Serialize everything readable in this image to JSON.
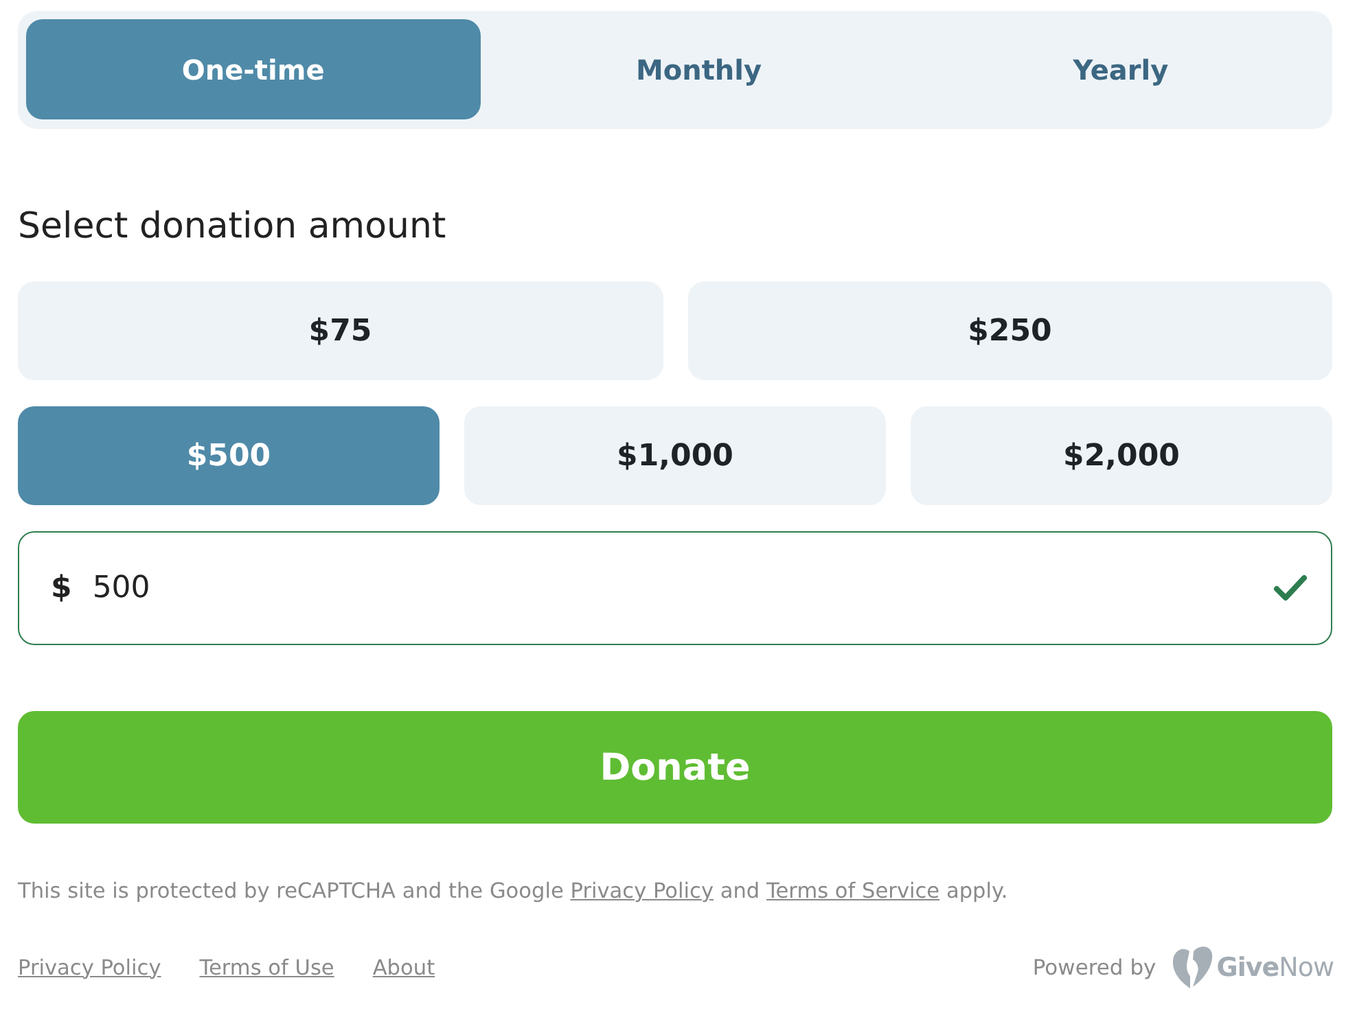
{
  "frequency_tabs": [
    {
      "label": "One-time",
      "selected": true
    },
    {
      "label": "Monthly",
      "selected": false
    },
    {
      "label": "Yearly",
      "selected": false
    }
  ],
  "amount_section": {
    "heading": "Select donation amount",
    "rows": [
      {
        "options": [
          {
            "label": "$75",
            "selected": false
          },
          {
            "label": "$250",
            "selected": false
          }
        ]
      },
      {
        "options": [
          {
            "label": "$500",
            "selected": true
          },
          {
            "label": "$1,000",
            "selected": false
          },
          {
            "label": "$2,000",
            "selected": false
          }
        ]
      }
    ]
  },
  "amount_field": {
    "currency": "$",
    "value": "500",
    "valid": true
  },
  "donate_button": {
    "label": "Donate"
  },
  "recaptcha_notice": {
    "parts": [
      {
        "kind": "text",
        "text": "This site is protected by reCAPTCHA and the Google "
      },
      {
        "kind": "link",
        "text": "Privacy Policy"
      },
      {
        "kind": "text",
        "text": " and "
      },
      {
        "kind": "link",
        "text": "Terms of Service"
      },
      {
        "kind": "text",
        "text": " apply."
      }
    ]
  },
  "footer": {
    "links": [
      "Privacy Policy",
      "Terms of Use",
      "About"
    ],
    "powered_by": {
      "label": "Powered by",
      "logo": "**Give**Now"
    }
  }
}
